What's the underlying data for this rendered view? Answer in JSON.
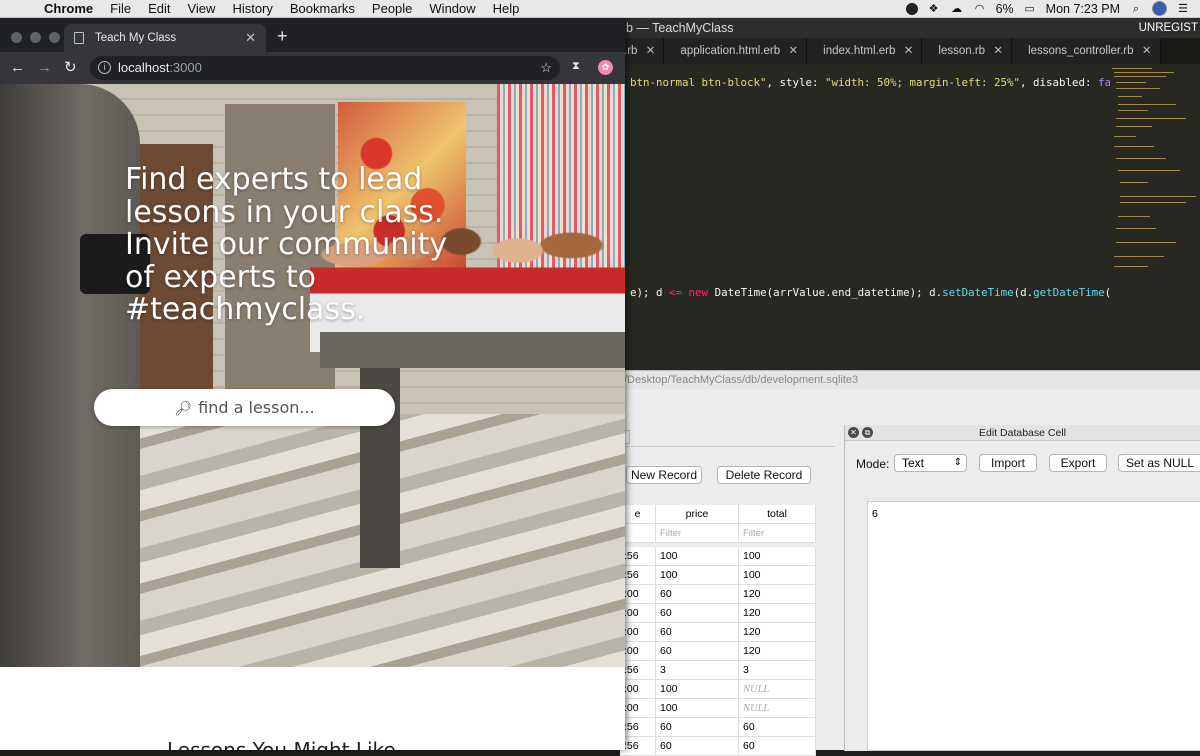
{
  "menubar": {
    "app": "Chrome",
    "items": [
      "File",
      "Edit",
      "View",
      "History",
      "Bookmarks",
      "People",
      "Window",
      "Help"
    ],
    "battery": "6%",
    "clock": "Mon 7:23 PM"
  },
  "editor": {
    "title": "b — TeachMyClass",
    "unregistered": "UNREGIST",
    "tabs": [
      ".rb",
      "application.html.erb",
      "index.html.erb",
      "lesson.rb",
      "lessons_controller.rb"
    ],
    "line1": {
      "a": "btn-normal btn-block\"",
      "b": ", style: ",
      "c": "\"width: 50%; margin-left: 25%\"",
      "d": ", disabled: ",
      "e": "false",
      "f": " %>"
    },
    "line2": {
      "a": "e); d ",
      "b": "<=",
      "c": " ",
      "d": "new",
      "e": " DateTime(arrValue.end_datetime); d.",
      "f": "setDateTime",
      "g": "(d.",
      "h": "getDateTime",
      "i": "())){"
    }
  },
  "db": {
    "path": "/Desktop/TeachMyClass/db/development.sqlite3",
    "new_record": "New Record",
    "delete_record": "Delete Record",
    "columns": [
      "e",
      "price",
      "total"
    ],
    "filter_placeholder": "Filter",
    "rows": [
      [
        ":56",
        "100",
        "100"
      ],
      [
        ":56",
        "100",
        "100"
      ],
      [
        ":00",
        "60",
        "120"
      ],
      [
        ":00",
        "60",
        "120"
      ],
      [
        ":00",
        "60",
        "120"
      ],
      [
        ":00",
        "60",
        "120"
      ],
      [
        ":56",
        "3",
        "3"
      ],
      [
        ":00",
        "100",
        "NULL"
      ],
      [
        ":00",
        "100",
        "NULL"
      ],
      [
        ":56",
        "60",
        "60"
      ],
      [
        ":56",
        "60",
        "60"
      ]
    ],
    "edit_cell": {
      "title": "Edit Database Cell",
      "mode_label": "Mode:",
      "mode_value": "Text",
      "import": "Import",
      "export": "Export",
      "set_null": "Set as NULL",
      "value": "6"
    }
  },
  "chrome": {
    "tab_title": "Teach My Class",
    "url_host": "localhost",
    "url_port": ":3000",
    "hero_text": "Find experts to lead lessons in your class. Invite our community of experts to #teachmyclass.",
    "search_placeholder": "find a lesson...",
    "section_heading": "Lessons You Might Like"
  },
  "colors": {
    "editor_bg": "#272822",
    "chrome_dark": "#202124",
    "chrome_toolbar": "#35363a"
  }
}
